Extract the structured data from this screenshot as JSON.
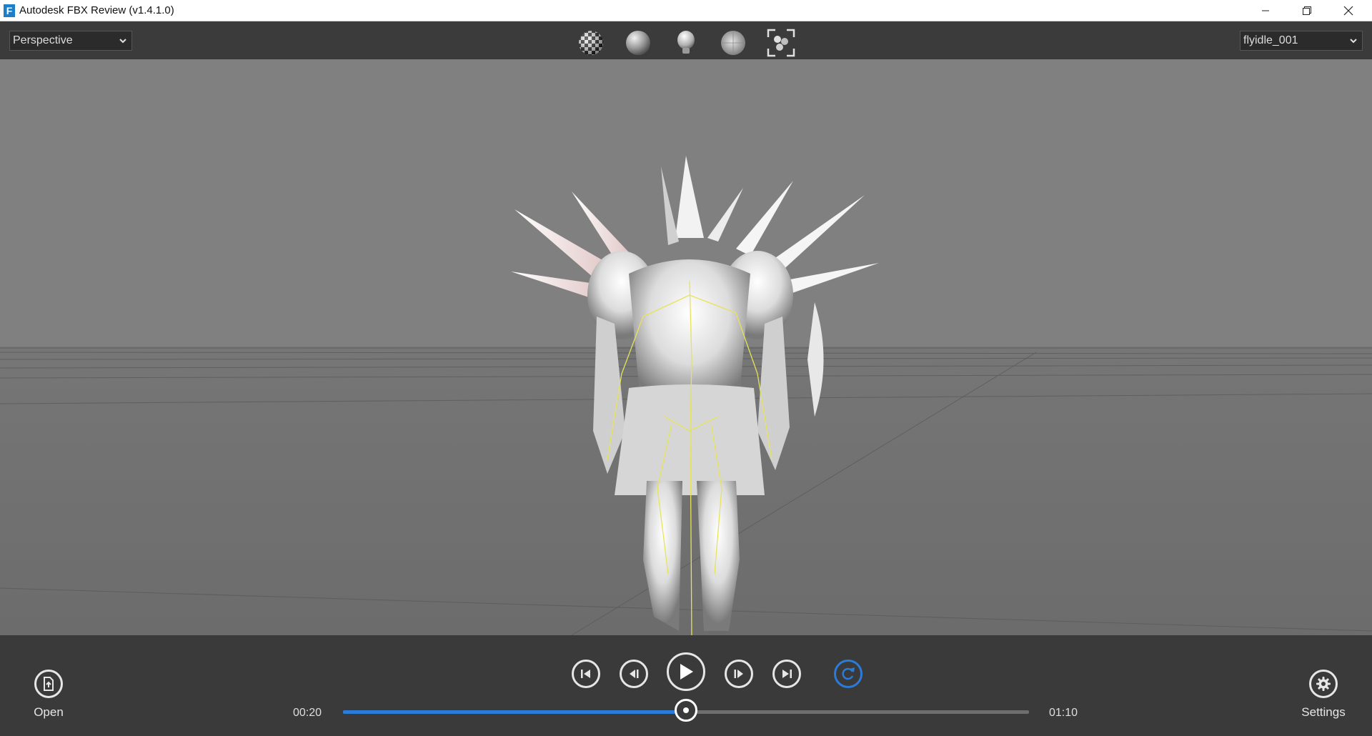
{
  "window": {
    "title": "Autodesk FBX Review (v1.4.1.0)",
    "app_icon_letter": "F"
  },
  "toolbar": {
    "camera_select": {
      "value": "Perspective"
    },
    "animation_select": {
      "value": "flyidle_001"
    },
    "tools": [
      "checker-texture-icon",
      "shaded-sphere-icon",
      "light-bulb-icon",
      "lit-sphere-icon",
      "frame-all-icon"
    ]
  },
  "playback": {
    "current_time": "00:20",
    "total_time": "01:10",
    "progress": 0.5,
    "controls": [
      "skip-to-start-icon",
      "step-back-icon",
      "play-icon",
      "step-forward-icon",
      "skip-to-end-icon",
      "loop-icon"
    ],
    "accent_color": "#2b7bd8"
  },
  "bottom": {
    "open_label": "Open",
    "settings_label": "Settings"
  }
}
